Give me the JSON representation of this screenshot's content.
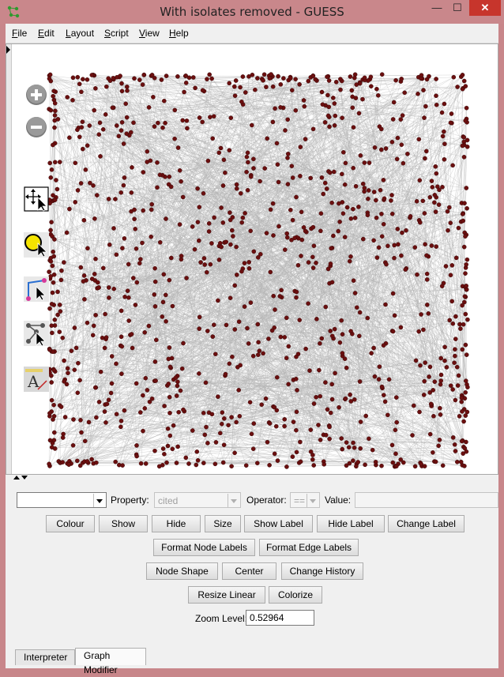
{
  "window": {
    "title": "With isolates removed - GUESS",
    "minimize_glyph": "—",
    "maximize_glyph": "☐",
    "close_glyph": "✕"
  },
  "menu": [
    {
      "mnemonic": "F",
      "rest": "ile"
    },
    {
      "mnemonic": "E",
      "rest": "dit"
    },
    {
      "mnemonic": "L",
      "rest": "ayout"
    },
    {
      "mnemonic": "S",
      "rest": "cript"
    },
    {
      "mnemonic": "V",
      "rest": "iew"
    },
    {
      "mnemonic": "H",
      "rest": "elp"
    }
  ],
  "tools": [
    "zoom-in-icon",
    "zoom-out-icon",
    "move-pan-icon",
    "select-node-icon",
    "draw-edge-icon",
    "node-drag-icon",
    "annotate-text-icon"
  ],
  "colors": {
    "node": "#6b0f0f",
    "edge": "#b4b4b4",
    "titlebar": "#c9878b"
  },
  "filter": {
    "property_label": "Property:",
    "property_value": "cited",
    "operator_label": "Operator:",
    "operator_value": "==",
    "value_label": "Value:",
    "value_text": ""
  },
  "buttons": {
    "colour": "Colour",
    "show": "Show",
    "hide": "Hide",
    "size": "Size",
    "show_label": "Show Label",
    "hide_label": "Hide Label",
    "change_label": "Change Label",
    "format_node_labels": "Format Node Labels",
    "format_edge_labels": "Format Edge Labels",
    "node_shape": "Node Shape",
    "center": "Center",
    "change_history": "Change History",
    "resize_linear": "Resize Linear",
    "colorize": "Colorize"
  },
  "zoom": {
    "label": "Zoom Level:",
    "value": "0.52964"
  },
  "tabs": [
    {
      "label": "Interpreter",
      "active": false
    },
    {
      "label": "Graph Modifier",
      "active": true
    }
  ]
}
